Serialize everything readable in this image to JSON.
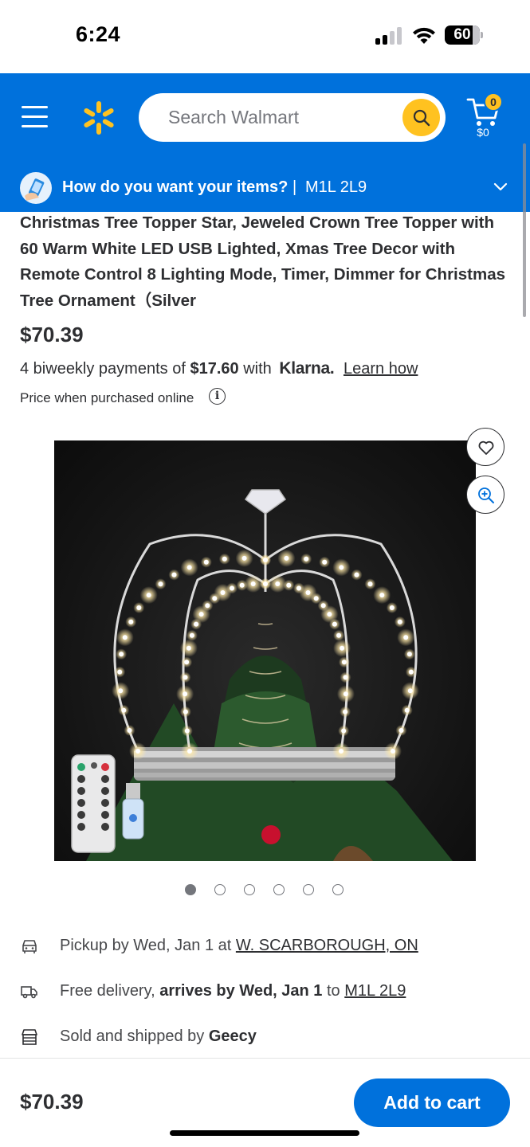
{
  "status_bar": {
    "time": "6:24",
    "battery": "60"
  },
  "header": {
    "search_placeholder": "Search Walmart",
    "cart_count": "0",
    "cart_total": "$0",
    "brand_color": "#0071dc",
    "accent_color": "#ffc220"
  },
  "delivery": {
    "question": "How do you want your items?",
    "divider": "|",
    "postal_code": "M1L 2L9"
  },
  "product": {
    "title": "Christmas Tree Topper Star, Jeweled Crown Tree Topper with 60 Warm White LED USB Lighted, Xmas Tree Decor with Remote Control 8 Lighting Mode, Timer, Dimmer for Christmas Tree Ornament（Silver",
    "price": "$70.39",
    "klarna": {
      "prefix": "4 biweekly payments of",
      "amount": "$17.60",
      "with": "with",
      "logo": "Klarna.",
      "link": "Learn how"
    },
    "price_note": "Price when purchased online",
    "info_icon": "i",
    "image_count": 6,
    "active_image_index": 0
  },
  "fulfillment": {
    "pickup": {
      "icon": "car-icon",
      "text": "Pickup by Wed, Jan 1 at",
      "store": "W. SCARBOROUGH, ON"
    },
    "delivery": {
      "icon": "truck-icon",
      "prefix": "Free delivery,",
      "arrives": "arrives by Wed, Jan 1",
      "to": "to",
      "postal": "M1L 2L9"
    },
    "seller": {
      "icon": "store-icon",
      "prefix": "Sold and shipped by",
      "name": "Geecy"
    }
  },
  "footer": {
    "price": "$70.39",
    "add_to_cart": "Add to cart"
  }
}
